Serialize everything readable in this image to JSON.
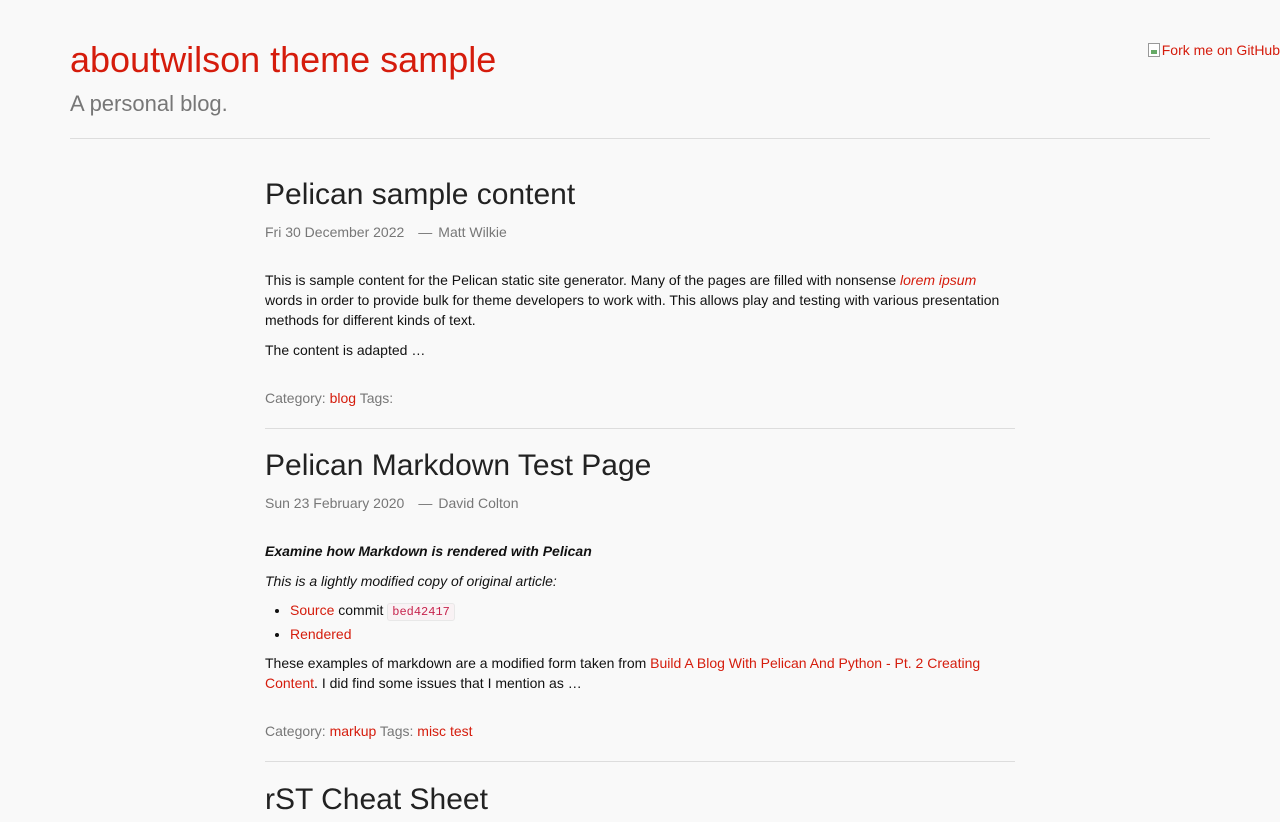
{
  "fork_ribbon": {
    "alt_text": "Fork me on GitHub"
  },
  "header": {
    "title": "aboutwilson theme sample",
    "subtitle": "A personal blog."
  },
  "posts": [
    {
      "title": "Pelican sample content",
      "date": "Fri 30 December 2022",
      "separator": "—",
      "author": "Matt Wilkie",
      "intro_before": "This is sample content for the Pelican static site generator. Many of the pages are filled with nonsense ",
      "intro_link": "lorem ipsum",
      "intro_after": " words in order to provide bulk for theme developers to work with. This allows play and testing with various presentation methods for different kinds of text.",
      "summary": "The content is adapted …",
      "category_label": "Category:",
      "category": "blog",
      "tags_label": "Tags:"
    },
    {
      "title": "Pelican Markdown Test Page",
      "date": "Sun 23 February 2020",
      "separator": "—",
      "author": "David Colton",
      "lead": "Examine how Markdown is rendered with Pelican",
      "note": "This is a lightly modified copy of original article:",
      "list": {
        "source_link": "Source",
        "commit_word": " commit ",
        "commit_hash": "bed42417",
        "rendered_link": "Rendered"
      },
      "para_before": "These examples of markdown are a modified form taken from ",
      "para_link": "Build A Blog With Pelican And Python - Pt. 2 Creating Content",
      "para_after": ". I did find some issues that I mention as …",
      "category_label": "Category:",
      "category": "markup",
      "tags_label": "Tags:",
      "tags": [
        "misc",
        "test"
      ]
    },
    {
      "title": "rST Cheat Sheet"
    }
  ],
  "colors": {
    "accent": "#d51c0c",
    "background": "#f9f9f9",
    "muted": "#777777",
    "text": "#111111",
    "divider": "#dddddd"
  }
}
